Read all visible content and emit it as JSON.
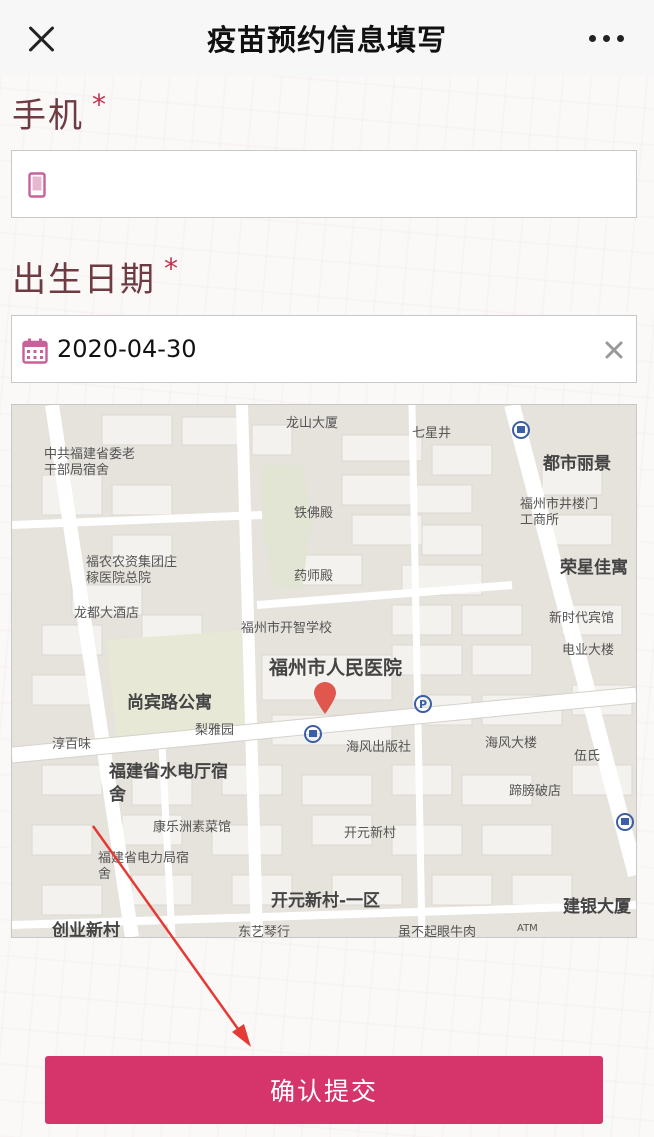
{
  "navbar": {
    "title": "疫苗预约信息填写",
    "close_icon": "close-icon",
    "more_icon": "more-horizontal-icon"
  },
  "form": {
    "phone": {
      "label": "手机",
      "required_mark": "*",
      "value": "",
      "icon": "mobile-phone-icon"
    },
    "dob": {
      "label": "出生日期",
      "required_mark": "*",
      "value": "2020-04-30",
      "icon": "calendar-icon",
      "clear_icon": "clear-icon"
    }
  },
  "map": {
    "marker_icon": "location-pin-icon",
    "labels": {
      "longshan": "龙山大厦",
      "qixingjing": "七星井",
      "dushilijing": "都市丽景",
      "zhonggong": "中共福建省委老干部局宿舍",
      "tiefodian": "铁佛殿",
      "shijing": "福州市井楼门工商所",
      "funong": "福农农资集团庄稼医院总院",
      "yaoshidian": "药师殿",
      "rongxing": "荣星佳寓",
      "longdu": "龙都大酒店",
      "kaizhi": "福州市开智学校",
      "xinshidai": "新时代宾馆",
      "dianye": "电业大楼",
      "renmin": "福州市人民医院",
      "shangbin": "尚宾路公寓",
      "liyayuan": "梨雅园",
      "chunbaiwei": "淳百味",
      "haifeng_press": "海风出版社",
      "haifeng_tower": "海风大楼",
      "wushi": "伍氏",
      "shuidian": "福建省水电厅宿舍",
      "tipengpo": "蹄膀破店",
      "kanglezhou": "康乐洲素菜馆",
      "kaiyuan": "开元新村",
      "dianli": "福建省电力局宿舍",
      "kaiyuan_one": "开元新村-一区",
      "jianyin": "建银大厦",
      "chuangye": "创业新村",
      "dongyi": "东艺琴行",
      "niurou": "虽不起眼牛肉",
      "atm": "ATM"
    }
  },
  "submit": {
    "label": "确认提交"
  },
  "colors": {
    "accent": "#d6356b",
    "label": "#6e3b42",
    "required": "#c2324c",
    "icon": "#c8609a"
  }
}
